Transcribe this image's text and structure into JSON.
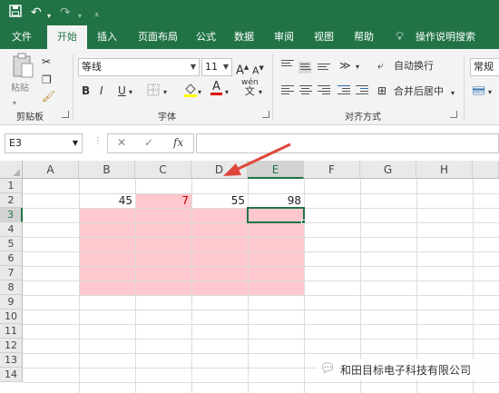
{
  "quick_access": {
    "save_icon": "save-icon",
    "undo_icon": "undo-icon",
    "redo_icon": "redo-icon",
    "customize_icon": "customize-qat-icon"
  },
  "tabs": [
    "文件",
    "开始",
    "插入",
    "页面布局",
    "公式",
    "数据",
    "审阅",
    "视图",
    "帮助"
  ],
  "active_tab": "开始",
  "tell_me": "操作说明搜索",
  "ribbon": {
    "clipboard": {
      "paste_label": "粘贴",
      "group_label": "剪贴板"
    },
    "font": {
      "font_name": "等线",
      "font_size": "11",
      "grow": "A",
      "shrink": "A",
      "bold": "B",
      "italic": "I",
      "underline": "U",
      "wen": "wén",
      "group_label": "字体"
    },
    "alignment": {
      "wrap_text": "自动换行",
      "merge_center": "合并后居中",
      "group_label": "对齐方式"
    },
    "number": {
      "format": "常规"
    }
  },
  "formula_bar": {
    "name_box": "E3",
    "cancel": "✕",
    "enter": "✓",
    "fx": "fx",
    "value": ""
  },
  "columns": [
    "A",
    "B",
    "C",
    "D",
    "E",
    "F",
    "G",
    "H"
  ],
  "rows": [
    "1",
    "2",
    "3",
    "4",
    "5",
    "6",
    "7",
    "8",
    "9",
    "10",
    "11",
    "12",
    "13",
    "14"
  ],
  "cells": {
    "B2": "45",
    "C2": "7",
    "D2": "55",
    "E2": "98"
  },
  "colors": {
    "excel_green": "#217346",
    "pink_fill": "#ffc7ce",
    "red_text": "#c00000",
    "arrow_red": "#e0463c"
  },
  "selected_cell": "E3",
  "watermark": "和田目标电子科技有限公司"
}
